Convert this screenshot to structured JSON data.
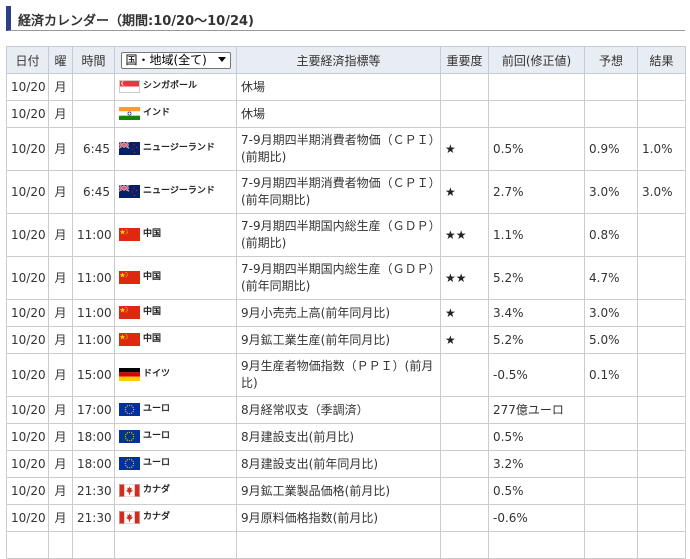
{
  "title": "経済カレンダー（期間:10/20〜10/24)",
  "headers": {
    "date": "日付",
    "day": "曜",
    "time": "時間",
    "region_select_value": "国・地域(全て)",
    "indicator": "主要経済指標等",
    "importance": "重要度",
    "previous": "前回(修正値)",
    "forecast": "予想",
    "result": "結果"
  },
  "colors": {
    "accent": "#2d3e8c",
    "header_bg": "#e8ecf3",
    "border": "#cccccc"
  },
  "rows": [
    {
      "date": "10/20",
      "day": "月",
      "time": "",
      "flag": "singapore-flag",
      "country": "シンガポール",
      "indicator": "休場",
      "importance": "",
      "previous": "",
      "forecast": "",
      "result": ""
    },
    {
      "date": "10/20",
      "day": "月",
      "time": "",
      "flag": "india-flag",
      "country": "インド",
      "indicator": "休場",
      "importance": "",
      "previous": "",
      "forecast": "",
      "result": ""
    },
    {
      "date": "10/20",
      "day": "月",
      "time": "6:45",
      "flag": "new-zealand-flag",
      "country": "ニュージーランド",
      "indicator": "7-9月期四半期消費者物価（ＣＰＩ）(前期比)",
      "importance": "★",
      "previous": "0.5%",
      "forecast": "0.9%",
      "result": "1.0%"
    },
    {
      "date": "10/20",
      "day": "月",
      "time": "6:45",
      "flag": "new-zealand-flag",
      "country": "ニュージーランド",
      "indicator": "7-9月期四半期消費者物価（ＣＰＩ）(前年同期比)",
      "importance": "★",
      "previous": "2.7%",
      "forecast": "3.0%",
      "result": "3.0%"
    },
    {
      "date": "10/20",
      "day": "月",
      "time": "11:00",
      "flag": "china-flag",
      "country": "中国",
      "indicator": "7-9月期四半期国内総生産（ＧＤＰ）(前期比)",
      "importance": "★★",
      "previous": "1.1%",
      "forecast": "0.8%",
      "result": ""
    },
    {
      "date": "10/20",
      "day": "月",
      "time": "11:00",
      "flag": "china-flag",
      "country": "中国",
      "indicator": "7-9月期四半期国内総生産（ＧＤＰ）(前年同期比)",
      "importance": "★★",
      "previous": "5.2%",
      "forecast": "4.7%",
      "result": ""
    },
    {
      "date": "10/20",
      "day": "月",
      "time": "11:00",
      "flag": "china-flag",
      "country": "中国",
      "indicator": "9月小売売上高(前年同月比)",
      "importance": "★",
      "previous": "3.4%",
      "forecast": "3.0%",
      "result": ""
    },
    {
      "date": "10/20",
      "day": "月",
      "time": "11:00",
      "flag": "china-flag",
      "country": "中国",
      "indicator": "9月鉱工業生産(前年同月比)",
      "importance": "★",
      "previous": "5.2%",
      "forecast": "5.0%",
      "result": ""
    },
    {
      "date": "10/20",
      "day": "月",
      "time": "15:00",
      "flag": "germany-flag",
      "country": "ドイツ",
      "indicator": "9月生産者物価指数（ＰＰＩ）(前月比)",
      "importance": "",
      "previous": "-0.5%",
      "forecast": "0.1%",
      "result": ""
    },
    {
      "date": "10/20",
      "day": "月",
      "time": "17:00",
      "flag": "eu-flag",
      "country": "ユーロ",
      "indicator": "8月経常収支（季調済）",
      "importance": "",
      "previous": "277億ユーロ",
      "forecast": "",
      "result": ""
    },
    {
      "date": "10/20",
      "day": "月",
      "time": "18:00",
      "flag": "eu-flag",
      "country": "ユーロ",
      "indicator": "8月建設支出(前月比)",
      "importance": "",
      "previous": "0.5%",
      "forecast": "",
      "result": ""
    },
    {
      "date": "10/20",
      "day": "月",
      "time": "18:00",
      "flag": "eu-flag",
      "country": "ユーロ",
      "indicator": "8月建設支出(前年同月比)",
      "importance": "",
      "previous": "3.2%",
      "forecast": "",
      "result": ""
    },
    {
      "date": "10/20",
      "day": "月",
      "time": "21:30",
      "flag": "canada-flag",
      "country": "カナダ",
      "indicator": "9月鉱工業製品価格(前月比)",
      "importance": "",
      "previous": "0.5%",
      "forecast": "",
      "result": ""
    },
    {
      "date": "10/20",
      "day": "月",
      "time": "21:30",
      "flag": "canada-flag",
      "country": "カナダ",
      "indicator": "9月原料価格指数(前月比)",
      "importance": "",
      "previous": "-0.6%",
      "forecast": "",
      "result": ""
    },
    {
      "date": "",
      "day": "",
      "time": "",
      "flag": "",
      "country": "",
      "indicator": "",
      "importance": "",
      "previous": "",
      "forecast": "",
      "result": ""
    }
  ]
}
